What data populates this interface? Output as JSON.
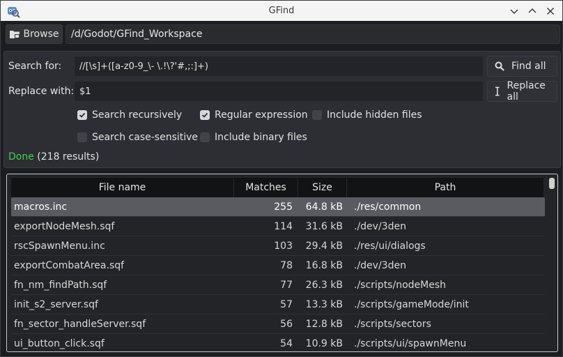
{
  "window": {
    "title": "GFind",
    "icon": "godot-search-icon"
  },
  "browse": {
    "button_label": "Browse",
    "path": "/d/Godot/GFind_Workspace"
  },
  "search": {
    "label": "Search for:",
    "value": "//[\\s]+([a-z0-9_\\- \\.!\\?'#,;:]+)",
    "button_label": "Find all"
  },
  "replace": {
    "label": "Replace with:",
    "value": "$1",
    "button_label": "Replace all"
  },
  "options": {
    "recursive": {
      "label": "Search recursively",
      "checked": true
    },
    "regex": {
      "label": "Regular expression",
      "checked": true
    },
    "hidden": {
      "label": "Include hidden files",
      "checked": false
    },
    "case_sensitive": {
      "label": "Search case-sensitive",
      "checked": false
    },
    "binary": {
      "label": "Include binary files",
      "checked": false
    }
  },
  "status": {
    "state": "Done",
    "count": "(218 results)"
  },
  "table": {
    "headers": [
      "File name",
      "Matches",
      "Size",
      "Path"
    ],
    "rows": [
      {
        "name": "macros.inc",
        "matches": "255",
        "size": "64.8 kB",
        "path": "./res/common"
      },
      {
        "name": "exportNodeMesh.sqf",
        "matches": "114",
        "size": "31.6 kB",
        "path": "./dev/3den"
      },
      {
        "name": "rscSpawnMenu.inc",
        "matches": "103",
        "size": "29.4 kB",
        "path": "./res/ui/dialogs"
      },
      {
        "name": "exportCombatArea.sqf",
        "matches": "78",
        "size": "16.8 kB",
        "path": "./dev/3den"
      },
      {
        "name": "fn_nm_findPath.sqf",
        "matches": "77",
        "size": "26.3 kB",
        "path": "./scripts/nodeMesh"
      },
      {
        "name": "init_s2_server.sqf",
        "matches": "57",
        "size": "13.3 kB",
        "path": "./scripts/gameMode/init"
      },
      {
        "name": "fn_sector_handleServer.sqf",
        "matches": "56",
        "size": "12.8 kB",
        "path": "./scripts/sectors"
      },
      {
        "name": "ui_button_click.sqf",
        "matches": "54",
        "size": "10.9 kB",
        "path": "./scripts/ui/spawnMenu"
      }
    ]
  }
}
